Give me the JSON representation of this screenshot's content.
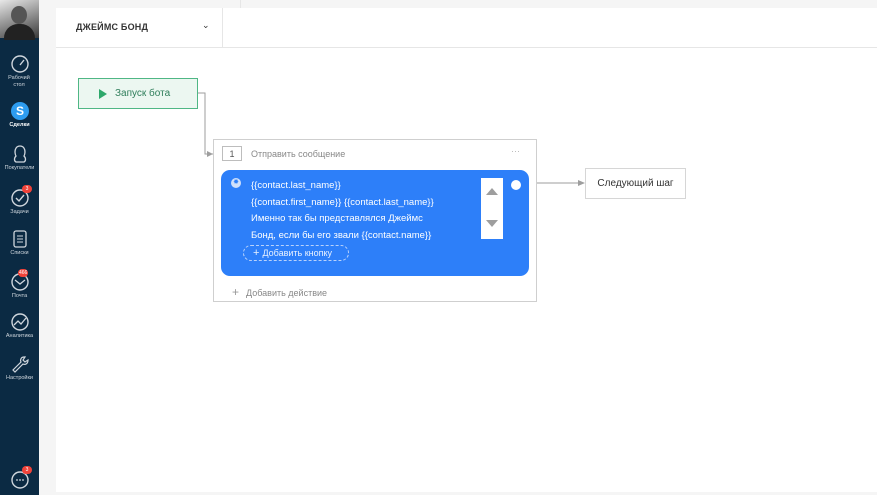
{
  "sidebar": {
    "items": [
      {
        "label": "Рабочий стол",
        "icon": "speedometer-icon"
      },
      {
        "label": "Сделки",
        "icon": "deals-icon",
        "active": true
      },
      {
        "label": "Покупатели",
        "icon": "customers-icon"
      },
      {
        "label": "Задачи",
        "icon": "tasks-icon",
        "badge": "3"
      },
      {
        "label": "Списки",
        "icon": "lists-icon"
      },
      {
        "label": "Почта",
        "icon": "mail-icon",
        "badge": "466"
      },
      {
        "label": "Аналитика",
        "icon": "analytics-icon"
      },
      {
        "label": "Настройки",
        "icon": "settings-icon"
      }
    ],
    "chat_badge": "3"
  },
  "header": {
    "bot_name": "ДЖЕЙМС БОНД"
  },
  "flow": {
    "start_label": "Запуск бота",
    "step": {
      "number": "1",
      "title": "Отправить сообщение",
      "message_lines": [
        "{{contact.last_name}}",
        "{{contact.first_name}} {{contact.last_name}}",
        "Именно так бы представлялся Джеймс",
        "Бонд, если бы его звали {{contact.name}}"
      ],
      "add_button_label": "Добавить кнопку",
      "add_action_label": "Добавить действие"
    },
    "next_step_label": "Следующий шаг"
  },
  "colors": {
    "sidebar_bg": "#0b2a43",
    "message_bg": "#2d7ff9",
    "start_border": "#4fb785",
    "badge": "#f0433a"
  }
}
